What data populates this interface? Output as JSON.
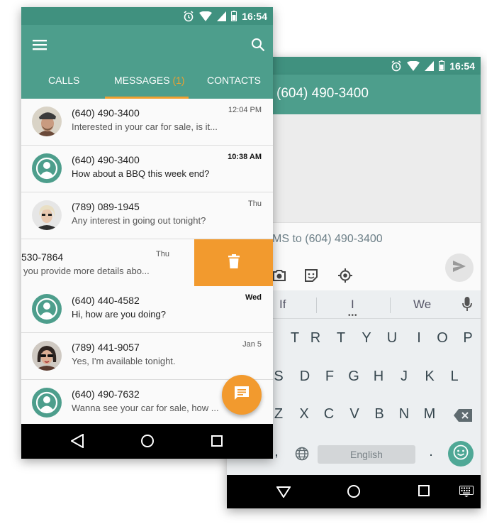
{
  "colors": {
    "primary": "#4d9e8c",
    "status_bar": "#40917f",
    "accent": "#f29a2e",
    "tab_indicator": "#f0a030"
  },
  "back_phone": {
    "status": {
      "time": "16:54"
    },
    "title": "(604) 490-3400",
    "compose_placeholder": "MS to (604) 490-3400",
    "compose_icons": [
      "camera-icon",
      "sticker-icon",
      "location-icon"
    ],
    "keyboard": {
      "suggestions": [
        "If",
        "I",
        "We"
      ],
      "row1": [
        "T",
        "R",
        "T",
        "Y",
        "U",
        "I",
        "O",
        "P"
      ],
      "row1_hints": [
        "",
        "",
        "",
        "",
        "",
        "",
        "",
        ""
      ],
      "row2": [
        "S",
        "D",
        "F",
        "G",
        "H",
        "J",
        "K",
        "L"
      ],
      "row3": [
        "Z",
        "X",
        "C",
        "V",
        "B",
        "N",
        "M"
      ],
      "comma": ",",
      "period": ".",
      "space_label": "English"
    }
  },
  "front_phone": {
    "status": {
      "time": "16:54"
    },
    "tabs": {
      "calls": "CALLS",
      "messages": "MESSAGES",
      "messages_badge": "(1)",
      "contacts": "CONTACTS"
    },
    "messages": [
      {
        "number": "(640) 490-3400",
        "preview": "Interested in your car for sale, is it...",
        "time": "12:04 PM",
        "unread": false,
        "avatar": "photo-man-cap"
      },
      {
        "number": "(640) 490-3400",
        "preview": "How about a BBQ this week end?",
        "time": "10:38 AM",
        "unread": true,
        "avatar": "generic"
      },
      {
        "number": "(789) 089-1945",
        "preview": "Any interest in going out tonight?",
        "time": "Thu",
        "unread": false,
        "avatar": "photo-woman-glasses"
      },
      {
        "number": "530-7864",
        "preview": "you provide more details abo...",
        "time": "Thu",
        "unread": false,
        "avatar": "none",
        "swiped": true
      },
      {
        "number": "(640) 440-4582",
        "preview": "Hi, how are you doing?",
        "time": "Wed",
        "unread": true,
        "avatar": "generic"
      },
      {
        "number": "(789) 441-9057",
        "preview": "Yes, I'm available tonight.",
        "time": "Jan 5",
        "unread": false,
        "avatar": "photo-woman-sunglasses"
      },
      {
        "number": "(640) 490-7632",
        "preview": "Wanna see your car for sale, how ...",
        "time": "",
        "unread": false,
        "avatar": "generic"
      }
    ]
  }
}
